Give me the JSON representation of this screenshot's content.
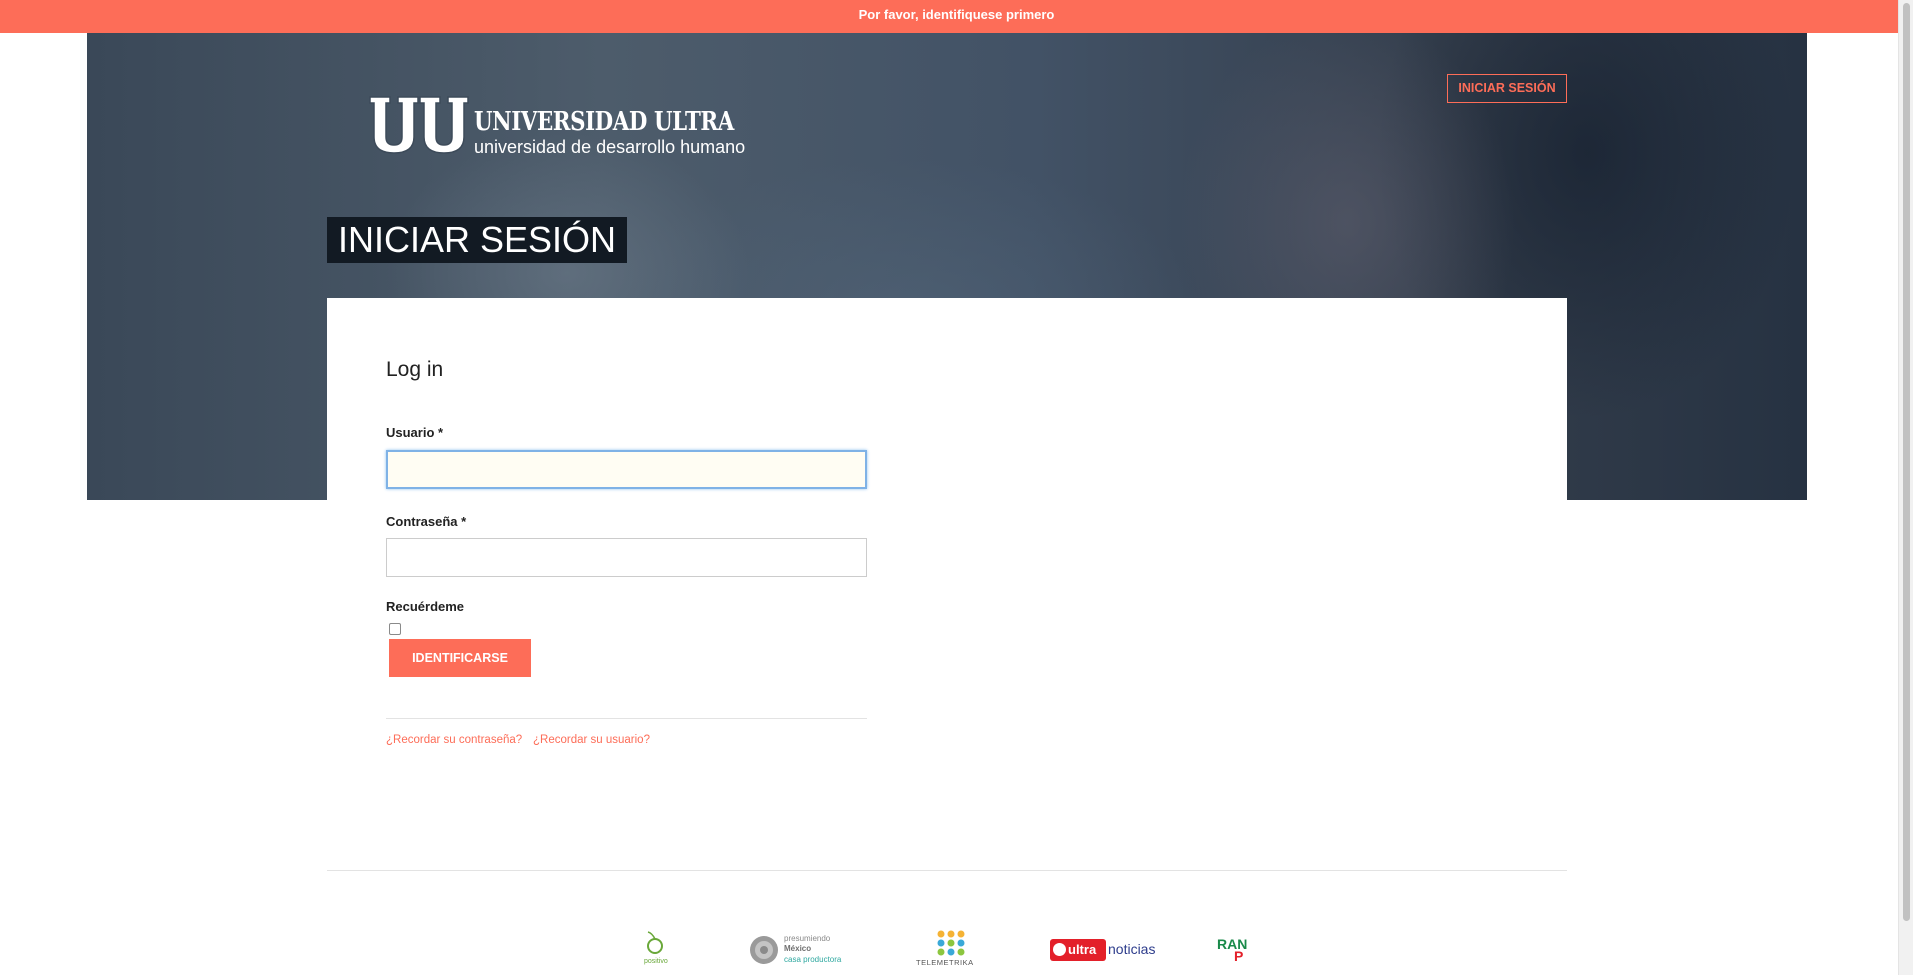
{
  "alert": {
    "message": "Por favor, identifiquese primero"
  },
  "header": {
    "logo": {
      "mark": "UU",
      "title": "UNIVERSIDAD ULTRA",
      "subtitle": "universidad de desarrollo humano"
    },
    "login_link": "INICIAR SESIÓN"
  },
  "page": {
    "title": "INICIAR SESIÓN"
  },
  "form": {
    "title": "Log in",
    "username_label": "Usuario *",
    "username_value": "",
    "password_label": "Contraseña *",
    "password_value": "",
    "remember_label": "Recuérdeme",
    "remember_checked": false,
    "submit_label": "IDENTIFICARSE",
    "forgot_password_link": "¿Recordar su contraseña?",
    "forgot_username_link": "¿Recordar su usuario?"
  },
  "footer": {
    "sponsors": [
      {
        "name": "positivo",
        "text": "positivo"
      },
      {
        "name": "presumiendo-mexico",
        "line1": "presumiendo",
        "line2": "México",
        "line3": "casa productora"
      },
      {
        "name": "telemetrika",
        "text": "TELEMETRIKA"
      },
      {
        "name": "ultra-noticias",
        "badge": "ultra",
        "word": "noticias"
      },
      {
        "name": "ranch",
        "top": "RAN",
        "bottom": "P"
      }
    ]
  },
  "colors": {
    "accent": "#fd6d58",
    "title_bg": "#121a23",
    "focus_border": "#7fb2e6",
    "link": "#fd6d58"
  }
}
